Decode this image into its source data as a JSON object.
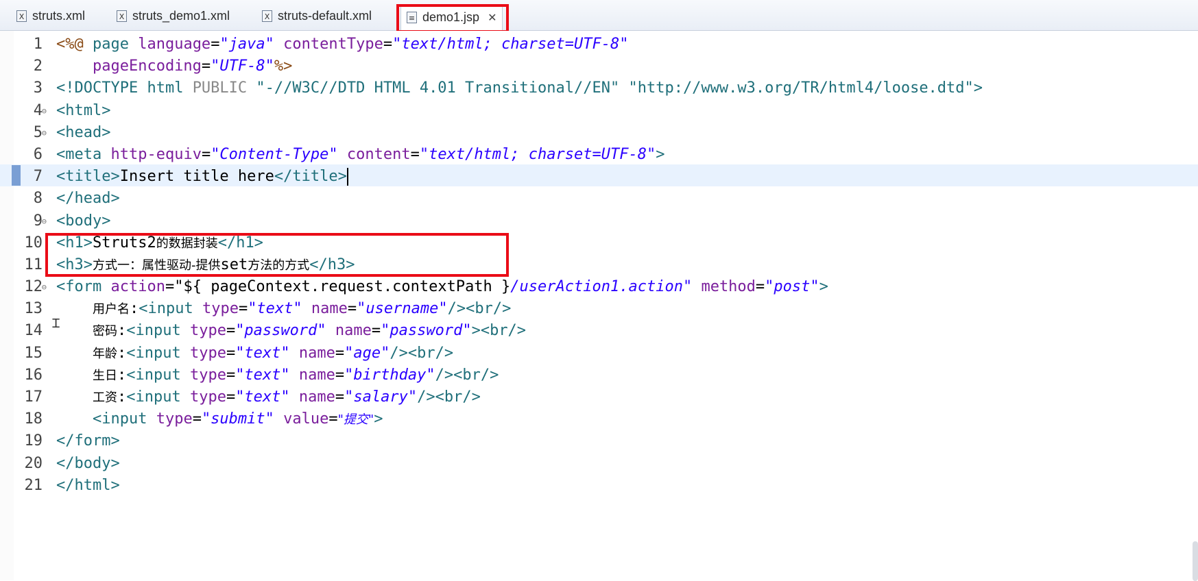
{
  "tabs": [
    {
      "label": "struts.xml",
      "icon": "xml-file-icon"
    },
    {
      "label": "struts_demo1.xml",
      "icon": "xml-file-icon"
    },
    {
      "label": "struts-default.xml",
      "icon": "xml-file-icon"
    },
    {
      "label": "demo1.jsp",
      "icon": "jsp-file-icon",
      "active": true
    }
  ],
  "tab_close_glyph": "✕",
  "highlight_color": "#ea0c17",
  "line_numbers": [
    "1",
    "2",
    "3",
    "4",
    "5",
    "6",
    "7",
    "8",
    "9",
    "10",
    "11",
    "12",
    "13",
    "14",
    "15",
    "16",
    "17",
    "18",
    "19",
    "20",
    "21"
  ],
  "lines": [
    [
      {
        "t": "<%@ ",
        "c": "dir"
      },
      {
        "t": "page ",
        "c": "tag"
      },
      {
        "t": "language",
        "c": "attr"
      },
      {
        "t": "=",
        "c": "txt"
      },
      {
        "t": "\"java\"",
        "c": "val"
      },
      {
        "t": " contentType",
        "c": "attr"
      },
      {
        "t": "=",
        "c": "txt"
      },
      {
        "t": "\"text/html; charset=UTF-8\"",
        "c": "val"
      }
    ],
    [
      {
        "t": "    pageEncoding",
        "c": "attr"
      },
      {
        "t": "=",
        "c": "txt"
      },
      {
        "t": "\"UTF-8\"",
        "c": "val"
      },
      {
        "t": "%>",
        "c": "dir"
      }
    ],
    [
      {
        "t": "<!DOCTYPE ",
        "c": "tag"
      },
      {
        "t": "html ",
        "c": "tag"
      },
      {
        "t": "PUBLIC ",
        "c": "gray"
      },
      {
        "t": "\"-//W3C//DTD HTML 4.01 Transitional//EN\" ",
        "c": "tag"
      },
      {
        "t": "\"http://www.w3.org/TR/html4/loose.dtd\"",
        "c": "tag"
      },
      {
        "t": ">",
        "c": "tag"
      }
    ],
    [
      {
        "t": "<html>",
        "c": "tag"
      }
    ],
    [
      {
        "t": "<head>",
        "c": "tag"
      }
    ],
    [
      {
        "t": "<meta ",
        "c": "tag"
      },
      {
        "t": "http-equiv",
        "c": "attr"
      },
      {
        "t": "=",
        "c": "txt"
      },
      {
        "t": "\"Content-Type\"",
        "c": "val"
      },
      {
        "t": " content",
        "c": "attr"
      },
      {
        "t": "=",
        "c": "txt"
      },
      {
        "t": "\"text/html; charset=UTF-8\"",
        "c": "val"
      },
      {
        "t": ">",
        "c": "tag"
      }
    ],
    [
      {
        "t": "<title>",
        "c": "tag"
      },
      {
        "t": "Insert title here",
        "c": "txt"
      },
      {
        "t": "</title>",
        "c": "tag"
      }
    ],
    [
      {
        "t": "</head>",
        "c": "tag"
      }
    ],
    [
      {
        "t": "<body>",
        "c": "tag"
      }
    ],
    [
      {
        "t": "<h1>",
        "c": "tag"
      },
      {
        "t": "Struts2",
        "c": "txt"
      },
      {
        "t": "的数据封装",
        "c": "txt",
        "cjk": true
      },
      {
        "t": "</h1>",
        "c": "tag"
      }
    ],
    [
      {
        "t": "<h3>",
        "c": "tag"
      },
      {
        "t": "方式一：属性驱动-提供",
        "c": "txt",
        "cjk": true
      },
      {
        "t": "set",
        "c": "txt"
      },
      {
        "t": "方法的方式",
        "c": "txt",
        "cjk": true
      },
      {
        "t": "</h3>",
        "c": "tag"
      }
    ],
    [
      {
        "t": "<form ",
        "c": "tag"
      },
      {
        "t": "action",
        "c": "attr"
      },
      {
        "t": "=",
        "c": "txt"
      },
      {
        "t": "\"${ pageContext.request.contextPath }",
        "c": "txt"
      },
      {
        "t": "/userAction1.action\"",
        "c": "val"
      },
      {
        "t": " method",
        "c": "attr"
      },
      {
        "t": "=",
        "c": "txt"
      },
      {
        "t": "\"post\"",
        "c": "val"
      },
      {
        "t": ">",
        "c": "tag"
      }
    ],
    [
      {
        "t": "    ",
        "c": "txt"
      },
      {
        "t": "用户名",
        "c": "txt",
        "cjk": true
      },
      {
        "t": ":",
        "c": "txt"
      },
      {
        "t": "<input ",
        "c": "tag"
      },
      {
        "t": "type",
        "c": "attr"
      },
      {
        "t": "=",
        "c": "txt"
      },
      {
        "t": "\"text\"",
        "c": "val"
      },
      {
        "t": " name",
        "c": "attr"
      },
      {
        "t": "=",
        "c": "txt"
      },
      {
        "t": "\"username\"",
        "c": "val"
      },
      {
        "t": "/><br/>",
        "c": "tag"
      }
    ],
    [
      {
        "t": "    ",
        "c": "txt"
      },
      {
        "t": "密码",
        "c": "txt",
        "cjk": true
      },
      {
        "t": ":",
        "c": "txt"
      },
      {
        "t": "<input ",
        "c": "tag"
      },
      {
        "t": "type",
        "c": "attr"
      },
      {
        "t": "=",
        "c": "txt"
      },
      {
        "t": "\"password\"",
        "c": "val"
      },
      {
        "t": " name",
        "c": "attr"
      },
      {
        "t": "=",
        "c": "txt"
      },
      {
        "t": "\"password\"",
        "c": "val"
      },
      {
        "t": "><br/>",
        "c": "tag"
      }
    ],
    [
      {
        "t": "    ",
        "c": "txt"
      },
      {
        "t": "年龄",
        "c": "txt",
        "cjk": true
      },
      {
        "t": ":",
        "c": "txt"
      },
      {
        "t": "<input ",
        "c": "tag"
      },
      {
        "t": "type",
        "c": "attr"
      },
      {
        "t": "=",
        "c": "txt"
      },
      {
        "t": "\"text\"",
        "c": "val"
      },
      {
        "t": " name",
        "c": "attr"
      },
      {
        "t": "=",
        "c": "txt"
      },
      {
        "t": "\"age\"",
        "c": "val"
      },
      {
        "t": "/><br/>",
        "c": "tag"
      }
    ],
    [
      {
        "t": "    ",
        "c": "txt"
      },
      {
        "t": "生日",
        "c": "txt",
        "cjk": true
      },
      {
        "t": ":",
        "c": "txt"
      },
      {
        "t": "<input ",
        "c": "tag"
      },
      {
        "t": "type",
        "c": "attr"
      },
      {
        "t": "=",
        "c": "txt"
      },
      {
        "t": "\"text\"",
        "c": "val"
      },
      {
        "t": " name",
        "c": "attr"
      },
      {
        "t": "=",
        "c": "txt"
      },
      {
        "t": "\"birthday\"",
        "c": "val"
      },
      {
        "t": "/><br/>",
        "c": "tag"
      }
    ],
    [
      {
        "t": "    ",
        "c": "txt"
      },
      {
        "t": "工资",
        "c": "txt",
        "cjk": true
      },
      {
        "t": ":",
        "c": "txt"
      },
      {
        "t": "<input ",
        "c": "tag"
      },
      {
        "t": "type",
        "c": "attr"
      },
      {
        "t": "=",
        "c": "txt"
      },
      {
        "t": "\"text\"",
        "c": "val"
      },
      {
        "t": " name",
        "c": "attr"
      },
      {
        "t": "=",
        "c": "txt"
      },
      {
        "t": "\"salary\"",
        "c": "val"
      },
      {
        "t": "/><br/>",
        "c": "tag"
      }
    ],
    [
      {
        "t": "    ",
        "c": "txt"
      },
      {
        "t": "<input ",
        "c": "tag"
      },
      {
        "t": "type",
        "c": "attr"
      },
      {
        "t": "=",
        "c": "txt"
      },
      {
        "t": "\"submit\"",
        "c": "val"
      },
      {
        "t": " value",
        "c": "attr"
      },
      {
        "t": "=",
        "c": "txt"
      },
      {
        "t": "\"提交\"",
        "c": "val",
        "cjk": true
      },
      {
        "t": ">",
        "c": "tag"
      }
    ],
    [
      {
        "t": "</form>",
        "c": "tag"
      }
    ],
    [
      {
        "t": "</body>",
        "c": "tag"
      }
    ],
    [
      {
        "t": "</html>",
        "c": "tag"
      }
    ]
  ],
  "fold_lines": [
    4,
    5,
    9,
    12
  ],
  "current_line": 7
}
